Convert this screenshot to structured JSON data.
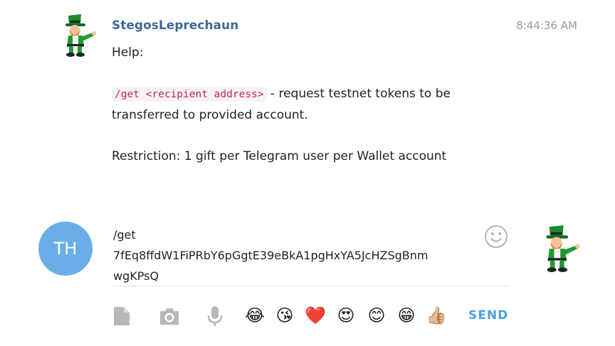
{
  "message": {
    "sender": "StegosLeprechaun",
    "time": "8:44:36 AM",
    "help_label": "Help:",
    "command_code": "/get <recipient address>",
    "command_desc": " - request testnet tokens to be transferred to provided account.",
    "restriction": "Restriction: 1 gift per Telegram user per Wallet account",
    "avatar_icon": "leprechaun-icon"
  },
  "composer": {
    "user_initials": "TH",
    "user_avatar_color": "#6aaee8",
    "input_value": "/get\n7fEq8ffdW1FiPRbY6pGgtE39eBkA1pgHxYA5JcHZSgBnm\nwgKPsQ",
    "send_label": "SEND",
    "accent_color": "#4da0e0"
  },
  "toolbar": {
    "attach_icon": "document-icon",
    "camera_icon": "camera-icon",
    "mic_icon": "microphone-icon",
    "emojis": [
      "😂",
      "😘",
      "❤️",
      "😍",
      "😊",
      "😁",
      "👍🏼"
    ]
  }
}
